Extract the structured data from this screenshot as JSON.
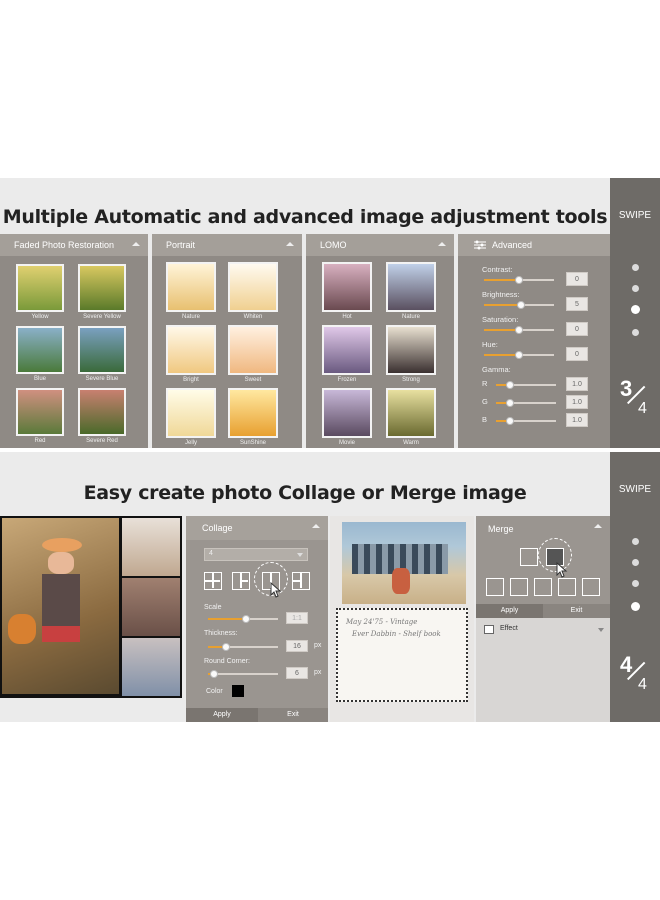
{
  "banner1": {
    "headline": "Multiple Automatic and advanced image adjustment tools",
    "swipe": "SWIPE",
    "page_current": "3",
    "page_total": "4",
    "panels": [
      {
        "title": "Faded Photo Restoration",
        "thumbs": [
          "Yellow",
          "Severe Yellow",
          "Blue",
          "Severe Blue",
          "Red",
          "Severe Red"
        ]
      },
      {
        "title": "Portrait",
        "thumbs": [
          "Nature",
          "Whiten",
          "Bright",
          "Sweet",
          "Jelly",
          "SunShine"
        ]
      },
      {
        "title": "LOMO",
        "thumbs": [
          "Hot",
          "Nature",
          "Frozen",
          "Strong",
          "Movie",
          "Warm"
        ]
      }
    ],
    "advanced": {
      "title": "Advanced",
      "rows": [
        {
          "label": "Contrast:",
          "value": "0"
        },
        {
          "label": "Brightness:",
          "value": "5"
        },
        {
          "label": "Saturation:",
          "value": "0"
        },
        {
          "label": "Hue:",
          "value": "0"
        }
      ],
      "gamma_label": "Gamma:",
      "gamma": [
        {
          "label": "R",
          "value": "1.0"
        },
        {
          "label": "G",
          "value": "1.0"
        },
        {
          "label": "B",
          "value": "1.0"
        }
      ]
    }
  },
  "banner2": {
    "headline": "Easy create photo Collage or Merge image",
    "swipe": "SWIPE",
    "page_current": "4",
    "page_total": "4",
    "collage": {
      "title": "Collage",
      "select_value": "4",
      "scale_label": "Scale",
      "scale_value": "1:1",
      "thickness_label": "Thickness:",
      "thickness_value": "16",
      "round_label": "Round Corner:",
      "round_value": "6",
      "unit": "px",
      "color_label": "Color",
      "apply": "Apply",
      "exit": "Exit"
    },
    "postcard_text": [
      "May 24'75 - Vintage",
      "Ever Dabbin - Shelf book"
    ],
    "merge": {
      "title": "Merge",
      "apply": "Apply",
      "exit": "Exit",
      "effect": "Effect"
    }
  },
  "colors": {
    "panel": "#8f8a85",
    "rail": "#6e6b67",
    "slider_fill": "#e8a030"
  }
}
